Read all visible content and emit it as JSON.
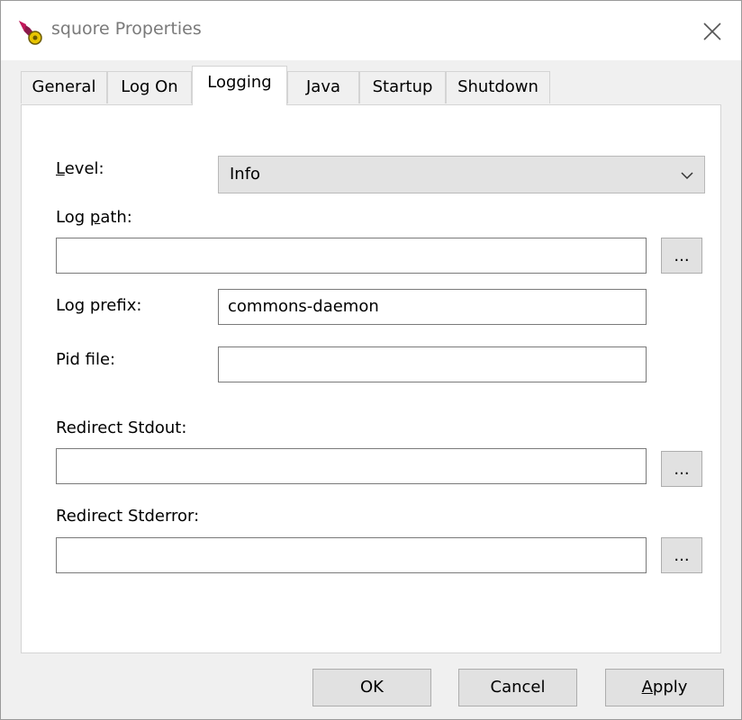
{
  "window": {
    "title": "squore Properties"
  },
  "tabs": [
    {
      "label": "General"
    },
    {
      "label": "Log On"
    },
    {
      "label": "Logging"
    },
    {
      "label": "Java"
    },
    {
      "label": "Startup"
    },
    {
      "label": "Shutdown"
    }
  ],
  "active_tab": "Logging",
  "logging": {
    "level": {
      "label_mnemonic": "L",
      "label_rest": "evel:",
      "value": "Info"
    },
    "log_path": {
      "label_pre": "Log ",
      "label_mnemonic": "p",
      "label_rest": "ath:",
      "value": "",
      "browse_label": "..."
    },
    "log_prefix": {
      "label": "Log prefix:",
      "value": "commons-daemon"
    },
    "pid_file": {
      "label": "Pid file:",
      "value": ""
    },
    "redirect_stdout": {
      "label": "Redirect Stdout:",
      "value": "",
      "browse_label": "..."
    },
    "redirect_stderror": {
      "label": "Redirect Stderror:",
      "value": "",
      "browse_label": "..."
    }
  },
  "buttons": {
    "ok": "OK",
    "cancel": "Cancel",
    "apply_mnemonic": "A",
    "apply_rest": "pply"
  }
}
